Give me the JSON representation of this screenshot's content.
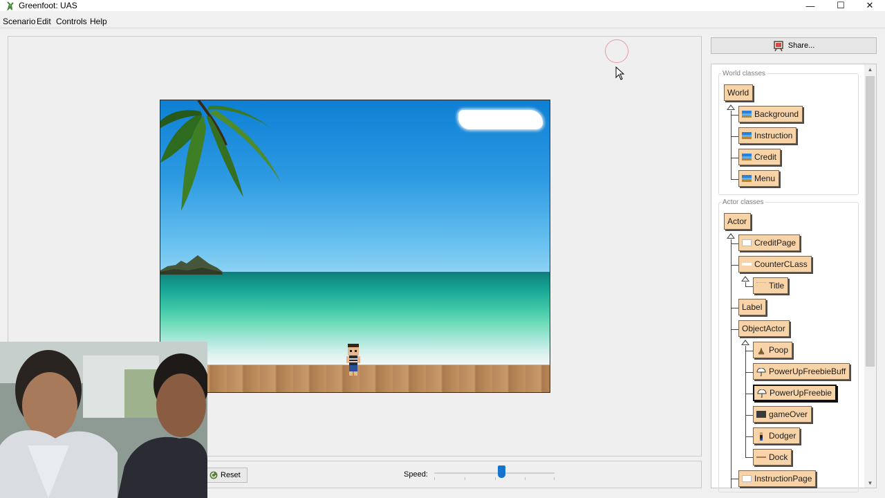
{
  "window": {
    "title": "Greenfoot: UAS",
    "minimize": "—",
    "maximize": "☐",
    "close": "✕"
  },
  "menu": [
    "Scenario",
    "Edit",
    "Controls",
    "Help"
  ],
  "share": {
    "label": "Share..."
  },
  "controls": {
    "reset_label": "Reset",
    "speed_label": "Speed:",
    "speed_value": 0.56
  },
  "world_classes": {
    "label": "World classes",
    "root": "World",
    "children": [
      "Background",
      "Instruction",
      "Credit",
      "Menu"
    ]
  },
  "actor_classes": {
    "label": "Actor classes",
    "root": "Actor",
    "items": [
      "CreditPage",
      "CounterCLass",
      "Title",
      "Label",
      "ObjectActor",
      "Poop",
      "PowerUpFreebieBuff",
      "PowerUpFreebie",
      "gameOver",
      "Dodger",
      "Dock",
      "InstructionPage"
    ],
    "selected": "PowerUpFreebie"
  },
  "colors": {
    "class_fill": "#f8d3a7",
    "slider_thumb": "#1574d0",
    "sky": "#2d9ae2",
    "sea": "#3cc6a6"
  }
}
